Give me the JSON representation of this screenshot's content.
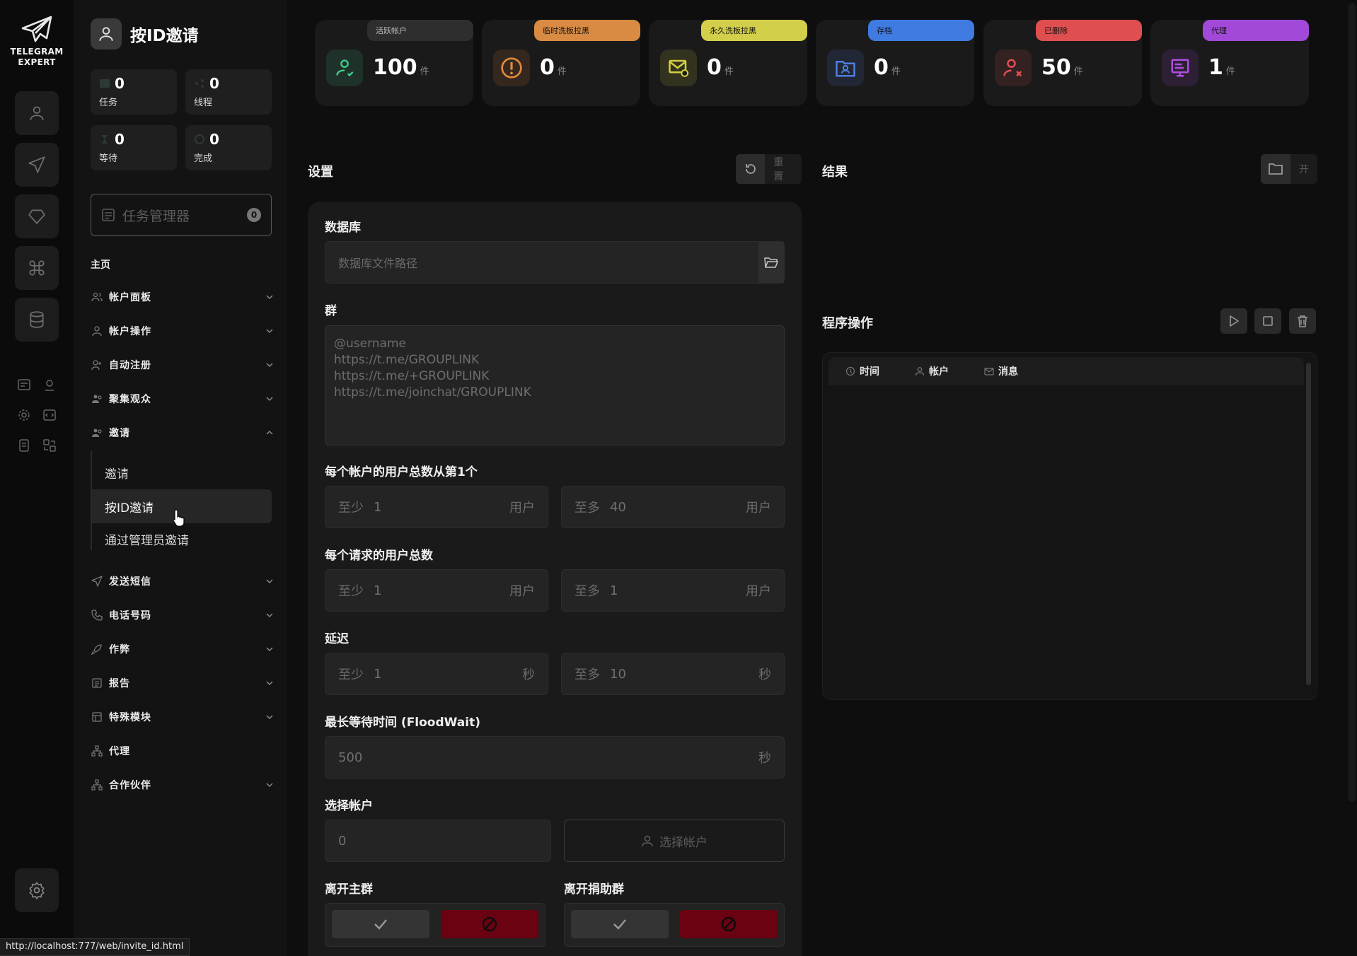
{
  "app": {
    "logo_line1": "TELEGRAM",
    "logo_line2": "EXPERT"
  },
  "page": {
    "title": "按ID邀请"
  },
  "sidebar_stats": [
    {
      "value": "0",
      "label": "任务",
      "icon": "list-icon"
    },
    {
      "value": "0",
      "label": "线程",
      "icon": "share-icon"
    },
    {
      "value": "0",
      "label": "等待",
      "icon": "hourglass-icon"
    },
    {
      "value": "0",
      "label": "完成",
      "icon": "check-circle-icon"
    }
  ],
  "task_manager": {
    "label": "任务管理器",
    "count": "0"
  },
  "nav": {
    "home": "主页",
    "items": [
      {
        "label": "帐户面板",
        "expanded": false
      },
      {
        "label": "帐户操作",
        "expanded": false
      },
      {
        "label": "自动注册",
        "expanded": false
      },
      {
        "label": "聚集观众",
        "expanded": false
      },
      {
        "label": "邀请",
        "expanded": true
      },
      {
        "label": "发送短信",
        "expanded": false
      },
      {
        "label": "电话号码",
        "expanded": false
      },
      {
        "label": "作弊",
        "expanded": false
      },
      {
        "label": "报告",
        "expanded": false
      },
      {
        "label": "特殊模块",
        "expanded": false
      },
      {
        "label": "代理",
        "expanded": null
      },
      {
        "label": "合作伙伴",
        "expanded": false
      }
    ],
    "invite_sub": [
      {
        "label": "邀请",
        "active": false
      },
      {
        "label": "按ID邀请",
        "active": true
      },
      {
        "label": "通过管理员邀请",
        "active": false
      }
    ]
  },
  "cards": [
    {
      "tag": "活跃帐户",
      "value": "100",
      "unit": "件",
      "tag_color": "#2e2e2e",
      "accent": "#3fcf8e",
      "icon": "user-active-icon"
    },
    {
      "tag": "临时洗板拉黑",
      "value": "0",
      "unit": "件",
      "tag_color": "#d98b43",
      "accent": "#e08a3c",
      "icon": "alert-circle-icon"
    },
    {
      "tag": "永久洗板拉黑",
      "value": "0",
      "unit": "件",
      "tag_color": "#d3cf4a",
      "accent": "#d4cf3f",
      "icon": "mail-ban-icon"
    },
    {
      "tag": "存档",
      "value": "0",
      "unit": "件",
      "tag_color": "#3f7be0",
      "accent": "#4f7fe0",
      "icon": "folder-user-icon"
    },
    {
      "tag": "已删除",
      "value": "50",
      "unit": "件",
      "tag_color": "#e04f4f",
      "accent": "#e04f55",
      "icon": "user-x-icon"
    },
    {
      "tag": "代理",
      "value": "1",
      "unit": "件",
      "tag_color": "#a349d9",
      "accent": "#b04de0",
      "icon": "proxy-icon"
    }
  ],
  "settings": {
    "title": "设置",
    "reset_label": "重置",
    "database_label": "数据库",
    "database_placeholder": "数据库文件路径",
    "group_label": "群",
    "group_placeholder": "@username\nhttps://t.me/GROUPLINK\nhttps://t.me/+GROUPLINK\nhttps://t.me/joinchat/GROUPLINK",
    "users_per_account_label": "每个帐户的用户总数从第1个",
    "users_per_request_label": "每个请求的用户总数",
    "delay_label": "延迟",
    "floodwait_label": "最长等待时间 (FloodWait)",
    "select_accounts_label": "选择帐户",
    "leave_main_label": "离开主群",
    "leave_donor_label": "离开捐助群",
    "min_prefix": "至少",
    "max_prefix": "至多",
    "unit_user": "用户",
    "unit_sec": "秒",
    "users_per_account": {
      "min": "1",
      "max": "40"
    },
    "users_per_request": {
      "min": "1",
      "max": "1"
    },
    "delay": {
      "min": "1",
      "max": "10"
    },
    "floodwait": "500",
    "selected_accounts": "0",
    "choose_accounts_btn": "选择帐户"
  },
  "results": {
    "title": "结果",
    "open_label": "开",
    "ops_title": "程序操作",
    "columns": [
      "时间",
      "帐户",
      "消息"
    ]
  },
  "status_bar": {
    "url": "http://localhost:777/web/invite_id.html"
  }
}
